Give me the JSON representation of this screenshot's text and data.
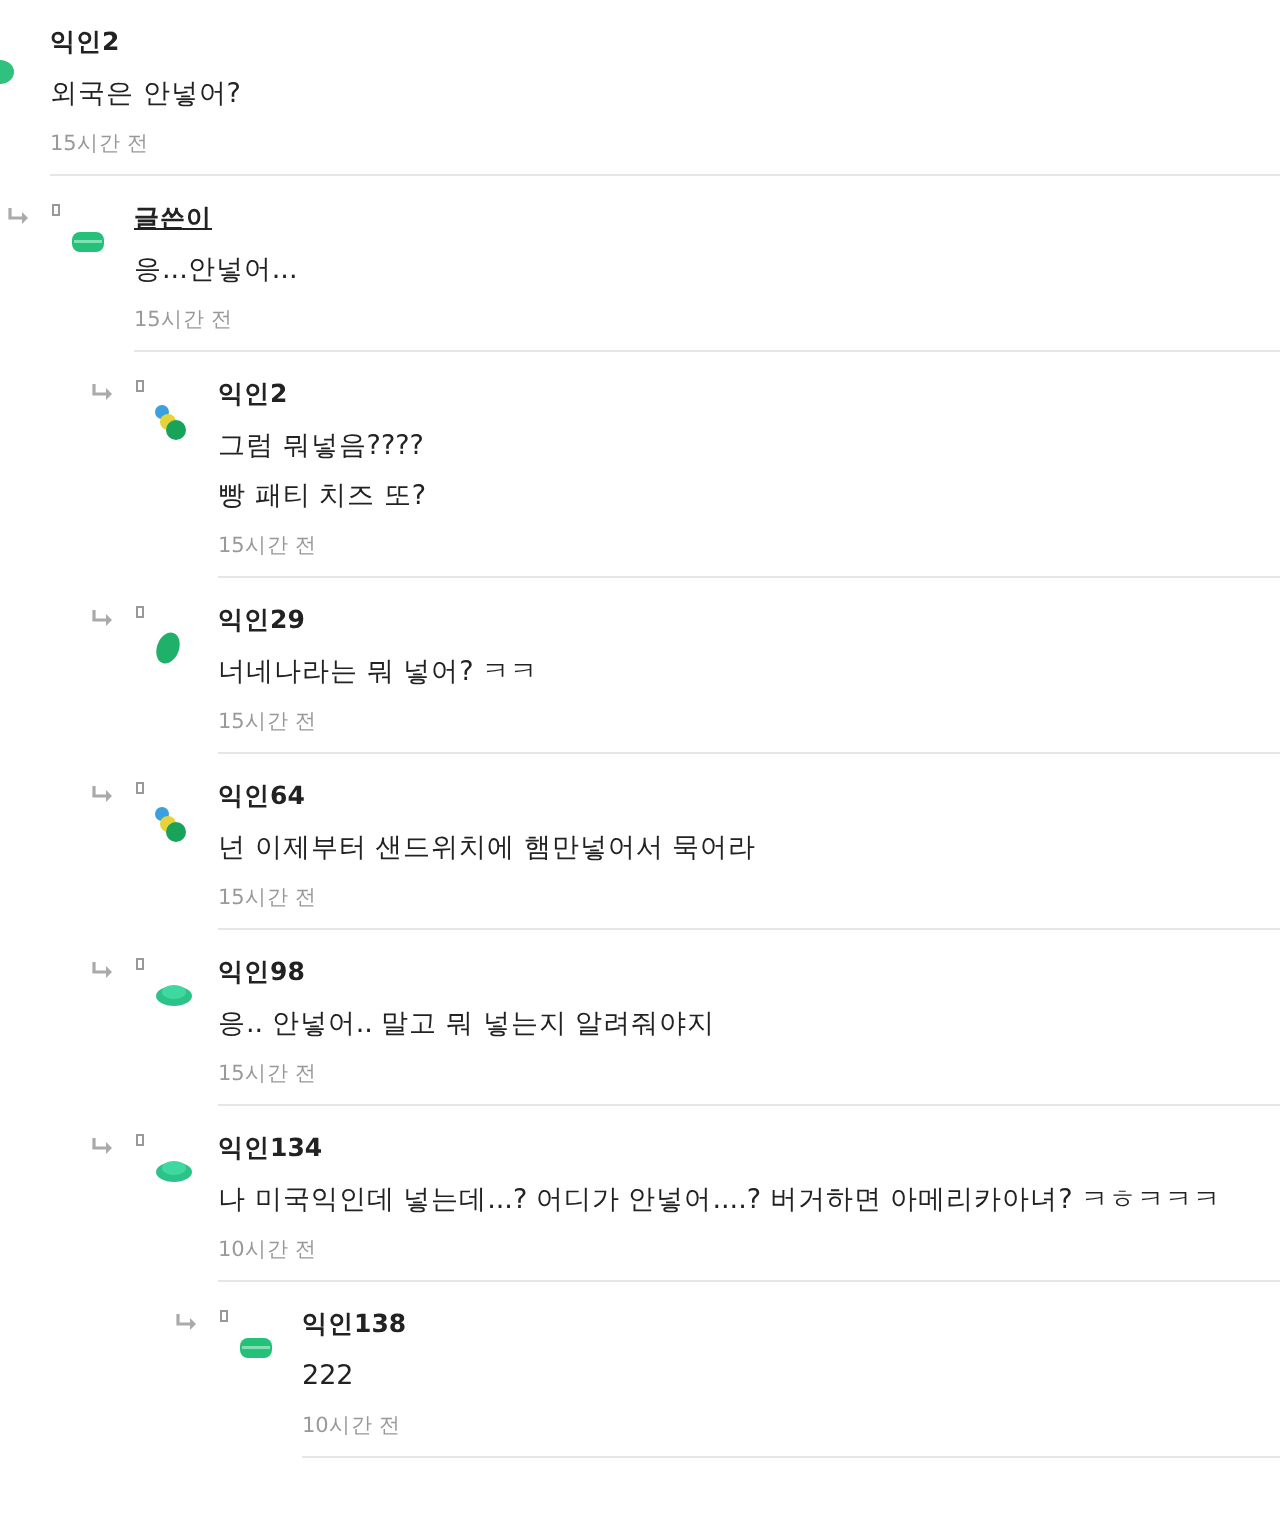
{
  "comments": [
    {
      "author": "익인2",
      "is_op": false,
      "kind": "half",
      "lines": [
        "외국은 안넣어?"
      ],
      "time": "15시간 전",
      "children": [
        {
          "author": "글쓴이",
          "is_op": true,
          "kind": "flat",
          "lines": [
            "응...안넣어..."
          ],
          "time": "15시간 전",
          "children": [
            {
              "author": "익인2",
              "is_op": false,
              "kind": "dots",
              "lines": [
                "그럼 뭐넣음????",
                "빵 패티 치즈 또?"
              ],
              "time": "15시간 전"
            },
            {
              "author": "익인29",
              "is_op": false,
              "kind": "blob",
              "lines": [
                "너네나라는 뭐 넣어? ㅋㅋ"
              ],
              "time": "15시간 전"
            },
            {
              "author": "익인64",
              "is_op": false,
              "kind": "dots",
              "lines": [
                "넌 이제부터 샌드위치에 햄만넣어서 묵어라"
              ],
              "time": "15시간 전"
            },
            {
              "author": "익인98",
              "is_op": false,
              "kind": "dome",
              "lines": [
                "응.. 안넣어.. 말고 뭐 넣는지 알려줘야지"
              ],
              "time": "15시간 전"
            },
            {
              "author": "익인134",
              "is_op": false,
              "kind": "dome",
              "lines": [
                "나 미국익인데 넣는데...? 어디가 안넣어....? 버거하면 아메리카아녀? ㅋㅎㅋㅋㅋ"
              ],
              "time": "10시간 전",
              "children": [
                {
                  "author": "익인138",
                  "is_op": false,
                  "kind": "flat",
                  "lines": [
                    "222"
                  ],
                  "time": "10시간 전"
                }
              ]
            }
          ]
        }
      ]
    }
  ]
}
